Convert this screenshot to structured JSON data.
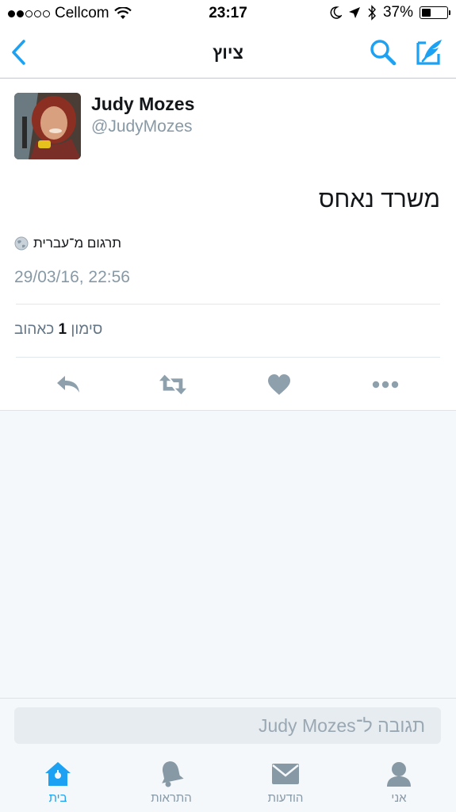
{
  "status_bar": {
    "carrier": "Cellcom",
    "time": "23:17",
    "battery_percent_label": "37%",
    "battery_level": 0.37,
    "signal_bars_filled": 2,
    "signal_bars_total": 5
  },
  "nav": {
    "title": "ציוץ",
    "icons": [
      "back-chevron-icon",
      "search-icon",
      "compose-tweet-icon"
    ]
  },
  "tweet": {
    "author_name": "Judy Mozes",
    "author_handle": "@JudyMozes",
    "text": "משרד נאחס",
    "translate_label": "תרגום מ־עברית",
    "timestamp": "29/03/16, 22:56",
    "likes_count": "1",
    "likes_label": "כאהוב",
    "likes_prefix": "סימון",
    "actions": [
      "reply-icon",
      "retweet-icon",
      "like-heart-icon",
      "more-dots-icon"
    ]
  },
  "reply": {
    "placeholder": "תגובה ל־Judy Mozes"
  },
  "tabs": [
    {
      "label": "בית",
      "icon": "home-icon",
      "active": true
    },
    {
      "label": "התראות",
      "icon": "bell-icon",
      "active": false
    },
    {
      "label": "הודעות",
      "icon": "envelope-icon",
      "active": false
    },
    {
      "label": "אני",
      "icon": "person-icon",
      "active": false
    }
  ],
  "colors": {
    "accent": "#1da1f2",
    "icon_gray": "#8899a6",
    "action_gray": "#8fa0ad"
  }
}
